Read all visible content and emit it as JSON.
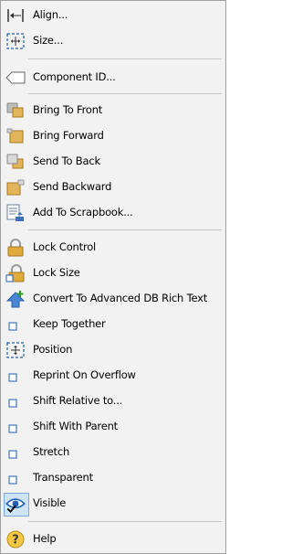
{
  "menu": {
    "items": [
      {
        "label": "Align...",
        "icon": "align-icon"
      },
      {
        "label": "Size...",
        "icon": "size-icon"
      },
      {
        "label": "Component ID...",
        "icon": "tag-icon"
      },
      {
        "label": "Bring To Front",
        "icon": "bring-to-front-icon"
      },
      {
        "label": "Bring Forward",
        "icon": "bring-forward-icon"
      },
      {
        "label": "Send To Back",
        "icon": "send-to-back-icon"
      },
      {
        "label": "Send Backward",
        "icon": "send-backward-icon"
      },
      {
        "label": "Add To Scrapbook...",
        "icon": "scrapbook-icon"
      },
      {
        "label": "Lock Control",
        "icon": "padlock-icon"
      },
      {
        "label": "Lock Size",
        "icon": "padlock-size-icon"
      },
      {
        "label": "Convert To Advanced DB Rich Text",
        "icon": "convert-arrow-icon"
      },
      {
        "label": "Keep Together",
        "icon": "checkbox-icon"
      },
      {
        "label": "Position",
        "icon": "position-icon"
      },
      {
        "label": "Reprint On Overflow",
        "icon": "checkbox-icon"
      },
      {
        "label": "Shift Relative to...",
        "icon": "checkbox-icon"
      },
      {
        "label": "Shift With Parent",
        "icon": "checkbox-icon"
      },
      {
        "label": "Stretch",
        "icon": "checkbox-icon"
      },
      {
        "label": "Transparent",
        "icon": "checkbox-icon"
      },
      {
        "label": "Visible",
        "icon": "visible-eye-icon",
        "checked": true
      },
      {
        "label": "Help",
        "icon": "help-icon"
      }
    ]
  },
  "colors": {
    "menu_background": "#f2f2f2",
    "separator": "#c8c8c8",
    "accent_blue": "#1e5fb4",
    "gold": "#d9a441",
    "checked_highlight": "#cfe3f7"
  }
}
